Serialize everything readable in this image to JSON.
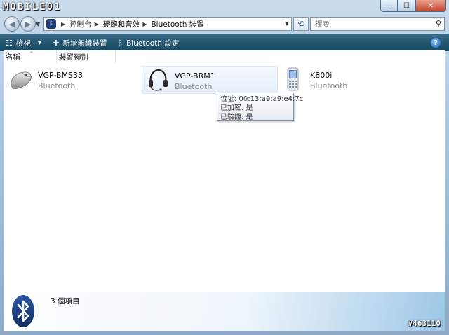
{
  "watermark": {
    "logo": "MOBILE01",
    "post_id": "#463110"
  },
  "window_buttons": {
    "minimize": "—",
    "maximize": "☐",
    "close": "✕"
  },
  "address_bar": {
    "breadcrumbs": [
      "控制台",
      "硬體和音效",
      "Bluetooth 裝置"
    ]
  },
  "search": {
    "placeholder": "搜尋"
  },
  "toolbar": {
    "view_label": "檢視",
    "add_device_label": "新增無線裝置",
    "settings_label": "Bluetooth 設定"
  },
  "columns": {
    "name": "名稱",
    "type": "裝置類別"
  },
  "devices": [
    {
      "name": "VGP-BMS33",
      "type": "Bluetooth",
      "icon": "mouse-icon"
    },
    {
      "name": "VGP-BRM1",
      "type": "Bluetooth",
      "icon": "headset-icon"
    },
    {
      "name": "K800i",
      "type": "Bluetooth",
      "icon": "phone-icon"
    }
  ],
  "tooltip": {
    "address": "位址: 00:13:a9:a9:e4:7c",
    "paired": "已加密: 是",
    "authenticated": "已驗證: 是"
  },
  "details": {
    "item_count": "3 個項目"
  },
  "colors": {
    "toolbar": "#245670",
    "accent": "#2a6bb0",
    "bluetooth": "#1d3e7c"
  }
}
